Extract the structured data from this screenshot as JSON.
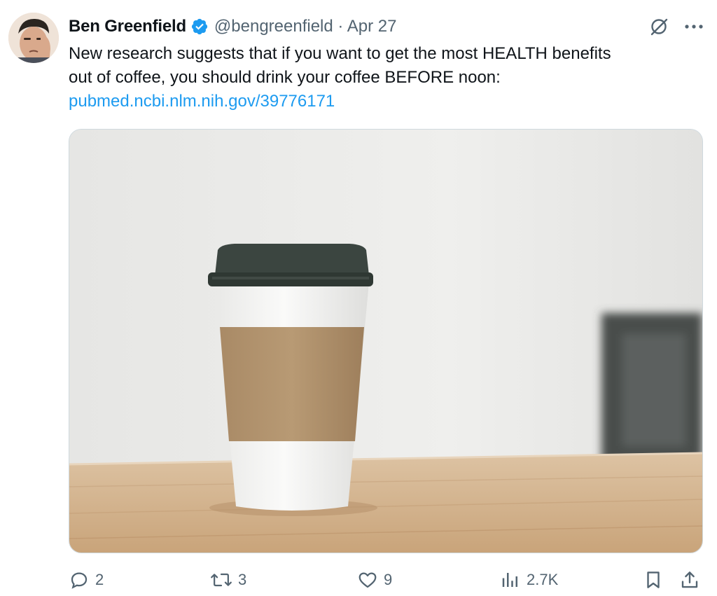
{
  "author": {
    "name": "Ben Greenfield",
    "handle": "@bengreenfield",
    "date": "Apr 27",
    "separator": "·",
    "verified_color": "#1d9bf0"
  },
  "tweet": {
    "line1": "New research suggests that if you want to get the most HEALTH benefits",
    "line2": "out of coffee, you should drink your coffee BEFORE noon:",
    "link": "pubmed.ncbi.nlm.nih.gov/39776171"
  },
  "media": {
    "subject": "coffee-cup-photo"
  },
  "actions": {
    "replies": "2",
    "reposts": "3",
    "likes": "9",
    "views": "2.7K"
  },
  "icons": [
    "grok-icon",
    "more-icon",
    "reply-icon",
    "repost-icon",
    "like-icon",
    "views-icon",
    "bookmark-icon",
    "share-icon"
  ]
}
